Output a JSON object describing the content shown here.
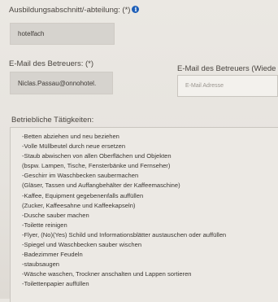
{
  "ausbildung": {
    "label": "Ausbildungsabschnitt/-abteilung: (*)",
    "value": "hotelfach"
  },
  "email_betreuer": {
    "label": "E-Mail des Betreuers: (*)",
    "value": "Niclas.Passau@onnohotel."
  },
  "email_betreuer_2": {
    "label": "E-Mail des Betreuers (Wiede",
    "placeholder": "E-Mail Adresse"
  },
  "taetigkeiten": {
    "label": "Betriebliche Tätigkeiten:",
    "lines": [
      "-Betten abziehen und neu beziehen",
      "-Volle Müllbeutel durch neue ersetzen",
      "-Staub abwischen von allen Oberflächen und Objekten",
      "(bspw. Lampen, Tische, Fensterbänke und Fernseher)",
      "-Geschirr im Waschbecken saubermachen",
      "(Gläser, Tassen und Auffangbehälter der Kaffeemaschine)",
      "-Kaffee, Equipment gegebenenfalls auffüllen",
      "(Zucker, Kaffeesahne und Kaffeekapseln)",
      "-Dusche sauber machen",
      "-Toilette reinigen",
      "-Flyer, (No)(Yes) Schild und Informationsblätter austauschen oder auffüllen",
      "-Spiegel und Waschbecken sauber wischen",
      "-Badezimmer Feudeln",
      "-staubsaugen",
      "-Wäsche waschen, Trockner anschalten und Lappen sortieren",
      "-Toilettenpapier auffüllen"
    ]
  }
}
